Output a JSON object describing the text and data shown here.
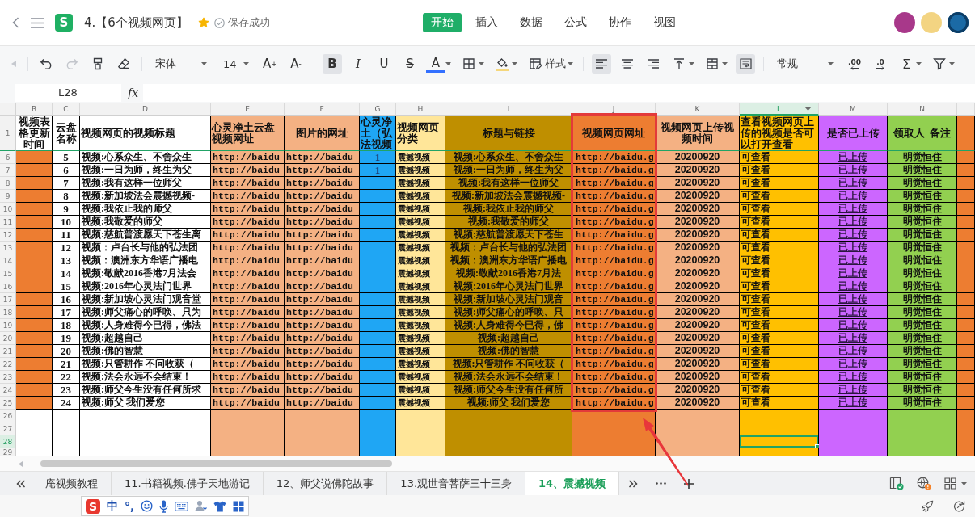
{
  "app_bar": {
    "logo_letter": "S",
    "title": "4.【6个视频网页】",
    "starred": true,
    "save_status": "保存成功",
    "menu_tabs": [
      {
        "label": "开始",
        "selected": true
      },
      {
        "label": "插入",
        "selected": false
      },
      {
        "label": "数据",
        "selected": false
      },
      {
        "label": "公式",
        "selected": false
      },
      {
        "label": "协作",
        "selected": false
      },
      {
        "label": "视图",
        "selected": false
      }
    ]
  },
  "toolbar": {
    "redo_disabled": true,
    "font": "宋体",
    "font_size": "14",
    "grow_font": "A$^{+}$",
    "shrink_font": "A$^{-}$",
    "format_buttons": [
      {
        "kind": "bold",
        "label": "B",
        "on": true
      },
      {
        "kind": "italic",
        "label": "I",
        "on": false
      },
      {
        "kind": "underline",
        "label": "U",
        "on": false
      },
      {
        "kind": "strike",
        "label": "S",
        "on": false
      }
    ],
    "font_color_label": "A",
    "style_label": "样式",
    "align_buttons": [
      {
        "kind": "left",
        "selected": true
      },
      {
        "kind": "center",
        "selected": false
      },
      {
        "kind": "right",
        "selected": false
      }
    ],
    "wrap_text": true,
    "number_format": "常规",
    "decimal_buttons": [
      {
        "kind": "more",
        "label": ".00"
      },
      {
        "kind": "fewer",
        "label": ".0"
      }
    ],
    "sum_label": "Σ"
  },
  "formula_bar": {
    "cell": "L28",
    "fx_label": "fx"
  },
  "sheet": {
    "header_row_number": "1",
    "columns": [
      {
        "letter": "B",
        "heading": {
          "text": "视频表格更新时间"
        },
        "kind": "marker",
        "selected": false,
        "highlighted": false
      },
      {
        "letter": "C",
        "heading": {
          "text": "云盘名称"
        },
        "kind": "data",
        "selected": false,
        "highlighted": false
      },
      {
        "letter": "D",
        "heading": {
          "text": "视频网页的视频标题"
        },
        "kind": "data",
        "selected": false,
        "highlighted": false
      },
      {
        "letter": "E",
        "heading": {
          "text": "心灵净土云盘视频网址",
          "color": "#f4b183"
        },
        "kind": "data",
        "color": "#f4b183",
        "selected": false,
        "highlighted": false
      },
      {
        "letter": "F",
        "heading": {
          "text": "图片的网址",
          "color": "#f4b183"
        },
        "kind": "data",
        "color": "#f4b183",
        "selected": false,
        "highlighted": false
      },
      {
        "letter": "G",
        "heading": {
          "text": "心灵净土（弘法视频",
          "color": "#1fa6f4"
        },
        "kind": "data",
        "color": "#1fa6f4",
        "selected": false,
        "highlighted": false
      },
      {
        "letter": "H",
        "heading": {
          "text": "视频网页分类",
          "color": "#ffe699"
        },
        "kind": "data",
        "color": "#ffe699",
        "selected": false,
        "highlighted": false
      },
      {
        "letter": "I",
        "heading": {
          "text": "标题与链接",
          "color": "#bf8f00"
        },
        "kind": "data",
        "color": "#bf8f00",
        "selected": false,
        "highlighted": false
      },
      {
        "letter": "J",
        "heading": {
          "text": "视频网页网址",
          "color": "#ed7d31"
        },
        "kind": "data",
        "color": "#ed7d31",
        "selected": false,
        "highlighted": true
      },
      {
        "letter": "K",
        "heading": {
          "text": "视频网页上传视频时间",
          "color": "#f4b183"
        },
        "kind": "data",
        "color": "#f4b183",
        "selected": false,
        "highlighted": false
      },
      {
        "letter": "L",
        "heading": {
          "text": "查看视频网页上传的视频是否可以打开查看",
          "color": "#ffc000"
        },
        "kind": "data",
        "color": "#ffc000",
        "selected": true,
        "highlighted": false
      },
      {
        "letter": "M",
        "heading": {
          "text": "是否已上传",
          "color": "#cc66ff"
        },
        "kind": "data",
        "color": "#cc66ff",
        "selected": false,
        "highlighted": false
      },
      {
        "letter": "N",
        "heading": {
          "text": "领取人  备注",
          "color": "#92d050"
        },
        "kind": "data",
        "color": "#92d050",
        "selected": false,
        "highlighted": false
      },
      {
        "heading": {
          "color": "#ed7d31"
        },
        "kind": "data",
        "color": "#ed7d31",
        "selected": false,
        "highlighted": false
      }
    ],
    "rows": [
      {
        "number": "6",
        "selected": false,
        "color": "#ed7d31",
        "disk_no": "5",
        "title": "视频:心系众生、不舍众生",
        "cloud_url": "http://baidu",
        "image_url": "http://baidu",
        "dharma_video": "1",
        "category": "震撼视频",
        "title_link": "视频:心系众生、不舍众生",
        "page_url": "http://baidu.g",
        "upload_time": "20200920",
        "viewable": "可查看",
        "uploaded": "已上传",
        "assignee": "明觉恒住"
      },
      {
        "number": "7",
        "selected": false,
        "color": "#ed7d31",
        "disk_no": "6",
        "title": "视频:一日为师，终生为父",
        "cloud_url": "http://baidu",
        "image_url": "http://baidu",
        "dharma_video": "1",
        "category": "震撼视频",
        "title_link": "视频:一日为师，终生为父",
        "page_url": "http://baidu.g",
        "upload_time": "20200920",
        "viewable": "可查看",
        "uploaded": "已上传",
        "assignee": "明觉恒住"
      },
      {
        "number": "8",
        "selected": false,
        "color": "#ed7d31",
        "disk_no": "7",
        "title": "视频:我有这样一位师父",
        "cloud_url": "http://baidu",
        "image_url": "http://baidu",
        "category": "震撼视频",
        "title_link": "视频:我有这样一位师父",
        "page_url": "http://baidu.g",
        "upload_time": "20200920",
        "viewable": "可查看",
        "uploaded": "已上传",
        "assignee": "明觉恒住"
      },
      {
        "number": "9",
        "selected": false,
        "color": "#ed7d31",
        "disk_no": "8",
        "title": "视频:新加坡法会震撼视频-",
        "cloud_url": "http://baidu",
        "image_url": "http://baidu",
        "category": "震撼视频",
        "title_link": "视频:新加坡法会震撼视频-",
        "page_url": "http://baidu.g",
        "upload_time": "20200920",
        "viewable": "可查看",
        "uploaded": "已上传",
        "assignee": "明觉恒住"
      },
      {
        "number": "10",
        "selected": false,
        "color": "#ed7d31",
        "disk_no": "9",
        "title": "视频:我依止我的师父",
        "cloud_url": "http://baidu",
        "image_url": "http://baidu",
        "category": "震撼视频",
        "title_link": "视频:我依止我的师父",
        "page_url": "http://baidu.g",
        "upload_time": "20200920",
        "viewable": "可查看",
        "uploaded": "已上传",
        "assignee": "明觉恒住"
      },
      {
        "number": "11",
        "selected": false,
        "color": "#ed7d31",
        "disk_no": "10",
        "title": "视频:我敬爱的师父",
        "cloud_url": "http://baidu",
        "image_url": "http://baidu",
        "category": "震撼视频",
        "title_link": "视频:我敬爱的师父",
        "page_url": "http://baidu.g",
        "upload_time": "20200920",
        "viewable": "可查看",
        "uploaded": "已上传",
        "assignee": "明觉恒住"
      },
      {
        "number": "12",
        "selected": false,
        "color": "#ed7d31",
        "disk_no": "11",
        "title": "视频:慈航普渡愿天下苍生离",
        "cloud_url": "http://baidu",
        "image_url": "http://baidu",
        "category": "震撼视频",
        "title_link": "视频:慈航普渡愿天下苍生",
        "page_url": "http://baidu.g",
        "upload_time": "20200920",
        "viewable": "可查看",
        "uploaded": "已上传",
        "assignee": "明觉恒住"
      },
      {
        "number": "13",
        "selected": false,
        "color": "#ed7d31",
        "disk_no": "12",
        "title": "视频：卢台长与他的弘法团",
        "cloud_url": "http://baidu",
        "image_url": "http://baidu",
        "category": "震撼视频",
        "title_link": "视频：卢台长与他的弘法团",
        "page_url": "http://baidu.g",
        "upload_time": "20200920",
        "viewable": "可查看",
        "uploaded": "已上传",
        "assignee": "明觉恒住"
      },
      {
        "number": "14",
        "selected": false,
        "color": "#ed7d31",
        "disk_no": "13",
        "title": "视频：澳洲东方华语广播电",
        "cloud_url": "http://baidu",
        "image_url": "http://baidu",
        "category": "震撼视频",
        "title_link": "视频：澳洲东方华语广播电",
        "page_url": "http://baidu.g",
        "upload_time": "20200920",
        "viewable": "可查看",
        "uploaded": "已上传",
        "assignee": "明觉恒住"
      },
      {
        "number": "15",
        "selected": false,
        "color": "#ed7d31",
        "disk_no": "14",
        "title": "视频:敬献2016香港7月法会",
        "cloud_url": "http://baidu",
        "image_url": "http://baidu",
        "category": "震撼视频",
        "title_link": "视频:敬献2016香港7月法",
        "page_url": "http://baidu.g",
        "upload_time": "20200920",
        "viewable": "可查看",
        "uploaded": "已上传",
        "assignee": "明觉恒住"
      },
      {
        "number": "16",
        "selected": false,
        "color": "#ed7d31",
        "disk_no": "15",
        "title": "视频:2016年心灵法门世界",
        "cloud_url": "http://baidu",
        "image_url": "http://baidu",
        "category": "震撼视频",
        "title_link": "视频:2016年心灵法门世界",
        "page_url": "http://baidu.g",
        "upload_time": "20200920",
        "viewable": "可查看",
        "uploaded": "已上传",
        "assignee": "明觉恒住"
      },
      {
        "number": "17",
        "selected": false,
        "color": "#ed7d31",
        "disk_no": "16",
        "title": "视频:新加坡心灵法门观音堂",
        "cloud_url": "http://baidu",
        "image_url": "http://baidu",
        "category": "震撼视频",
        "title_link": "视频:新加坡心灵法门观音",
        "page_url": "http://baidu.g",
        "upload_time": "20200920",
        "viewable": "可查看",
        "uploaded": "已上传",
        "assignee": "明觉恒住"
      },
      {
        "number": "18",
        "selected": false,
        "color": "#ed7d31",
        "disk_no": "17",
        "title": "视频:师父痛心的呼唤、只为",
        "cloud_url": "http://baidu",
        "image_url": "http://baidu",
        "category": "震撼视频",
        "title_link": "视频:师父痛心的呼唤、只",
        "page_url": "http://baidu.g",
        "upload_time": "20200920",
        "viewable": "可查看",
        "uploaded": "已上传",
        "assignee": "明觉恒住"
      },
      {
        "number": "19",
        "selected": false,
        "color": "#ed7d31",
        "disk_no": "18",
        "title": "视频:人身难得今已得，佛法",
        "cloud_url": "http://baidu",
        "image_url": "http://baidu",
        "category": "震撼视频",
        "title_link": "视频:人身难得今已得，佛",
        "page_url": "http://baidu.g",
        "upload_time": "20200920",
        "viewable": "可查看",
        "uploaded": "已上传",
        "assignee": "明觉恒住"
      },
      {
        "number": "20",
        "selected": false,
        "color": "#ed7d31",
        "disk_no": "19",
        "title": "视频:超越自己",
        "cloud_url": "http://baidu",
        "image_url": "http://baidu",
        "category": "震撼视频",
        "title_link": "视频:超越自己",
        "page_url": "http://baidu.g",
        "upload_time": "20200920",
        "viewable": "可查看",
        "uploaded": "已上传",
        "assignee": "明觉恒住"
      },
      {
        "number": "21",
        "selected": false,
        "color": "#ed7d31",
        "disk_no": "20",
        "title": "视频:佛的智慧",
        "cloud_url": "http://baidu",
        "image_url": "http://baidu",
        "category": "震撼视频",
        "title_link": "视频:佛的智慧",
        "page_url": "http://baidu.g",
        "upload_time": "20200920",
        "viewable": "可查看",
        "uploaded": "已上传",
        "assignee": "明觉恒住"
      },
      {
        "number": "22",
        "selected": false,
        "color": "#ed7d31",
        "disk_no": "21",
        "title": "视频:只管耕作 不问收获（",
        "cloud_url": "http://baidu",
        "image_url": "http://baidu",
        "category": "震撼视频",
        "title_link": "视频:只管耕作 不问收获（",
        "page_url": "http://baidu.g",
        "upload_time": "20200920",
        "viewable": "可查看",
        "uploaded": "已上传",
        "assignee": "明觉恒住"
      },
      {
        "number": "23",
        "selected": false,
        "color": "#ed7d31",
        "disk_no": "22",
        "title": "视频:法会永远不会结束！",
        "cloud_url": "http://baidu",
        "image_url": "http://baidu",
        "category": "震撼视频",
        "title_link": "视频:法会永远不会结束！",
        "page_url": "http://baidu.g",
        "upload_time": "20200920",
        "viewable": "可查看",
        "uploaded": "已上传",
        "assignee": "明觉恒住"
      },
      {
        "number": "24",
        "selected": false,
        "color": "#ed7d31",
        "disk_no": "23",
        "title": "视频:师父今生没有任何所求",
        "cloud_url": "http://baidu",
        "image_url": "http://baidu",
        "category": "震撼视频",
        "title_link": "视频:师父今生没有任何所",
        "page_url": "http://baidu.g",
        "upload_time": "20200920",
        "viewable": "可查看",
        "uploaded": "已上传",
        "assignee": "明觉恒住"
      },
      {
        "number": "25",
        "selected": false,
        "color": "#ed7d31",
        "disk_no": "24",
        "title": "视频:师父 我们爱您",
        "cloud_url": "http://baidu",
        "image_url": "http://baidu",
        "category": "震撼视频",
        "title_link": "视频:师父 我们爱您",
        "page_url": "http://baidu.g",
        "upload_time": "20200920",
        "viewable": "可查看",
        "uploaded": "已上传",
        "assignee": "明觉恒住"
      },
      {
        "number": "26",
        "selected": false
      },
      {
        "number": "27",
        "selected": false
      },
      {
        "number": "28",
        "selected": true
      },
      {
        "number": "29",
        "selected": false
      }
    ]
  },
  "sheet_tabs": [
    {
      "label": "庵视频教程",
      "selected": false
    },
    {
      "label": "11.书籍视频.佛子天地游记",
      "selected": false
    },
    {
      "label": "12、师父说佛陀故事",
      "selected": false
    },
    {
      "label": "13.观世音菩萨三十三身",
      "selected": false
    },
    {
      "label": "14、震撼视频",
      "selected": true
    }
  ],
  "ime": {
    "logo_letter": "S",
    "mode": "中",
    "punctuation": "°,"
  }
}
